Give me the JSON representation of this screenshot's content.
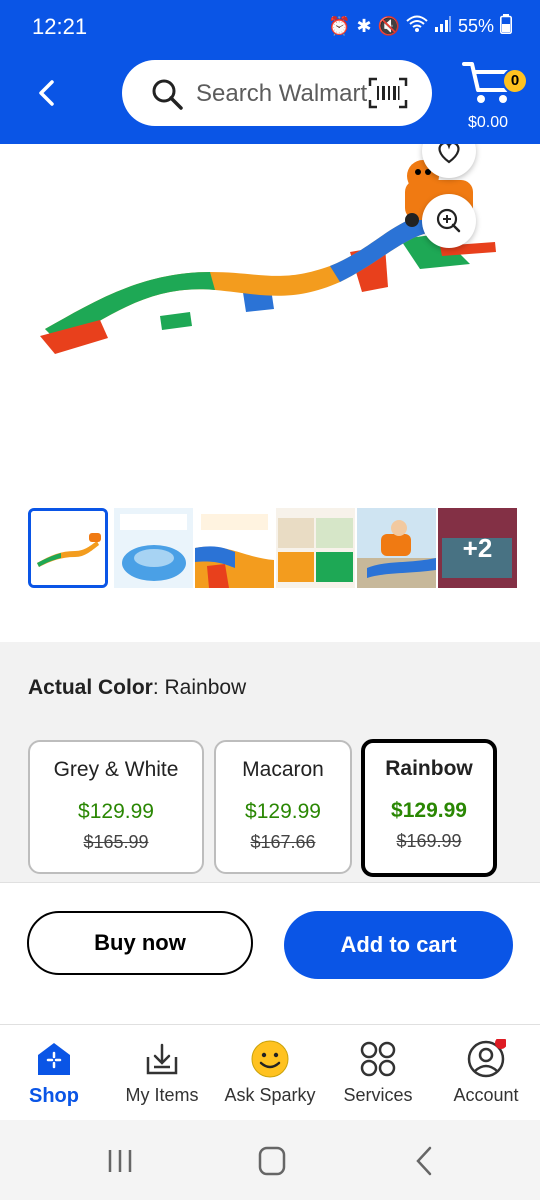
{
  "status": {
    "time": "12:21",
    "battery": "55%"
  },
  "search": {
    "placeholder": "Search Walmart"
  },
  "cart": {
    "count": "0",
    "amount": "$0.00"
  },
  "thumbnails": {
    "more_label": "+2"
  },
  "options": {
    "actual_label": "Actual Color",
    "actual_value": ": Rainbow",
    "items": [
      {
        "name": "Grey & White",
        "price": "$129.99",
        "was": "$165.99"
      },
      {
        "name": "Macaron",
        "price": "$129.99",
        "was": "$167.66"
      },
      {
        "name": "Rainbow",
        "price": "$129.99",
        "was": "$169.99"
      }
    ]
  },
  "actions": {
    "buy_now": "Buy now",
    "add_to_cart": "Add to cart"
  },
  "nav": {
    "items": [
      {
        "label": "Shop"
      },
      {
        "label": "My Items"
      },
      {
        "label": "Ask Sparky"
      },
      {
        "label": "Services"
      },
      {
        "label": "Account"
      }
    ]
  },
  "colors": {
    "brand_blue": "#0a55e6",
    "price_green": "#2a8703",
    "badge_yellow": "#ffc220"
  }
}
